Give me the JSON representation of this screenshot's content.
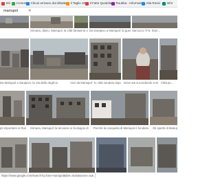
{
  "bookmarks": [
    {
      "label": "Siti",
      "color": "#e53935"
    },
    {
      "label": "Cronomo",
      "color": "#43a047"
    },
    {
      "label": "Chiusi arrivano dal dibatte...",
      "color": "#1e88e5"
    },
    {
      "label": "Il Taglio 190",
      "color": "#fb8c00"
    },
    {
      "label": "Il Fatto Quotidiano",
      "color": "#e53935"
    },
    {
      "label": "Roubba - Informatici...",
      "color": "#8e24aa"
    },
    {
      "label": "Alta Rossi",
      "color": "#1e88e5"
    },
    {
      "label": "Infor",
      "color": "#00897b"
    }
  ],
  "search": {
    "query": "mariupol",
    "close_icon": "close-icon"
  },
  "rows": [
    {
      "items": [
        {
          "caption": "",
          "source": ""
        },
        {
          "caption": "Sirnana, diario, Mariupol, la città fantasma vista per ...",
          "source": ""
        },
        {
          "caption": "",
          "source": ""
        },
        {
          "caption": "Da Sarajevo a Mariupol: la guerra e la morte della pe...",
          "source": ""
        },
        {
          "caption": "Sarcocco Ti-6: Ston...",
          "source": ""
        }
      ]
    },
    {
      "items": [
        {
          "caption": "Da Mariupol a Sarajevo: la Via delle degli'ordine...",
          "source": ""
        },
        {
          "caption": "Voci da Mariupol: 'In città venduto dopo...",
          "source": ""
        },
        {
          "caption": "",
          "source": ""
        },
        {
          "caption": "Dove sta succedendo a Mariupol...",
          "source": ""
        },
        {
          "caption": "Città pe...",
          "source": ""
        }
      ]
    },
    {
      "items": [
        {
          "caption": "Sirnana, Mariupol: la tensione si fa doppio di guerra...",
          "source": ""
        },
        {
          "caption": "",
          "source": ""
        },
        {
          "caption": "Perché la conquista di Mariupol è fondamentale...",
          "source": ""
        },
        {
          "caption": "",
          "source": ""
        },
        {
          "caption": "Gli spettri di Mariupol...",
          "source": ""
        }
      ]
    }
  ],
  "left_captions": {
    "row3": "pti importanti in Russia - ..."
  },
  "status": {
    "url": "https://www.google.com/search?q=foto+mariupol&tbm=isch&source=iu&ictx=1&fir=..."
  }
}
